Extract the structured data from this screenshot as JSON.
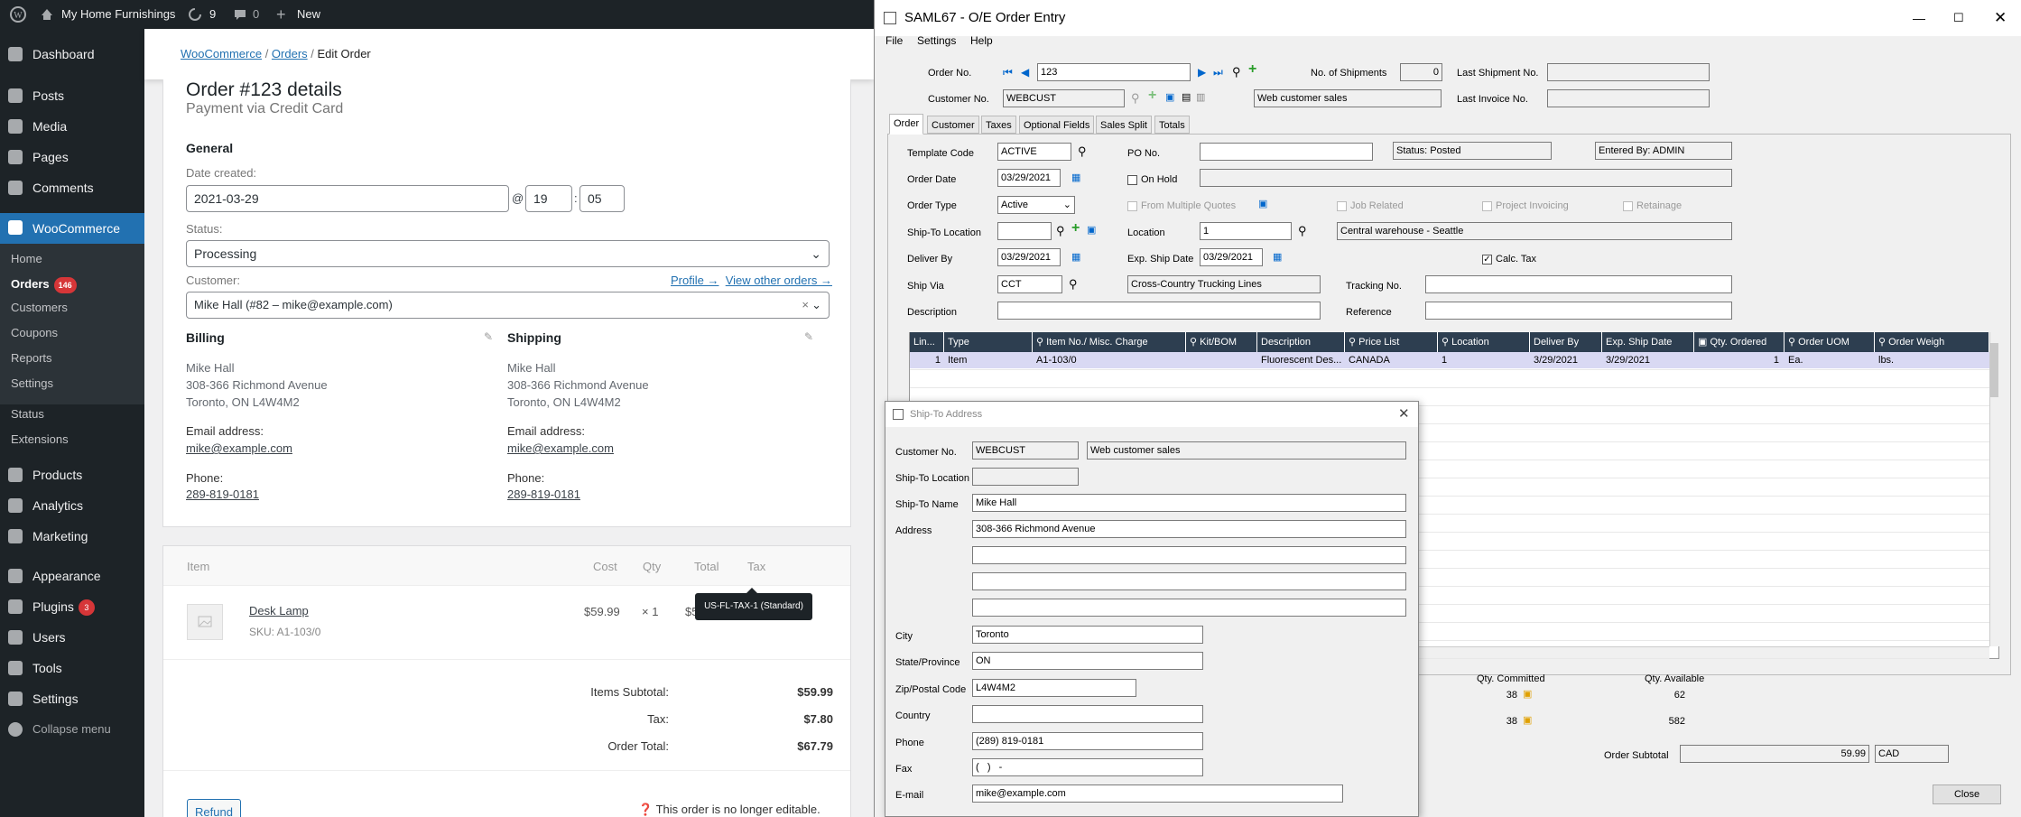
{
  "adminbar": {
    "site_name": "My Home Furnishings",
    "updates_count": "9",
    "comments_count": "0",
    "new_label": "New"
  },
  "sidebar": {
    "items": [
      {
        "label": "Dashboard"
      },
      {
        "label": "Posts"
      },
      {
        "label": "Media"
      },
      {
        "label": "Pages"
      },
      {
        "label": "Comments"
      },
      {
        "label": "WooCommerce"
      },
      {
        "label": "Products"
      },
      {
        "label": "Analytics"
      },
      {
        "label": "Marketing"
      },
      {
        "label": "Appearance"
      },
      {
        "label": "Plugins"
      },
      {
        "label": "Users"
      },
      {
        "label": "Tools"
      },
      {
        "label": "Settings"
      },
      {
        "label": "Collapse menu"
      }
    ],
    "plugins_badge": "3",
    "woo_sub": [
      {
        "label": "Home"
      },
      {
        "label": "Orders"
      },
      {
        "label": "Customers"
      },
      {
        "label": "Coupons"
      },
      {
        "label": "Reports"
      },
      {
        "label": "Settings"
      },
      {
        "label": "Status"
      },
      {
        "label": "Extensions"
      }
    ],
    "orders_badge": "146"
  },
  "breadcrumb": {
    "root": "WooCommerce",
    "orders": "Orders",
    "current": "Edit Order"
  },
  "order": {
    "title": "Order #123 details",
    "payment": "Payment via Credit Card",
    "general_label": "General",
    "date_label": "Date created:",
    "date_value": "2021-03-29",
    "at": "@",
    "hour": "19",
    "colon": ":",
    "minute": "05",
    "status_label": "Status:",
    "status_value": "Processing",
    "customer_label": "Customer:",
    "profile_link": "Profile →",
    "other_orders_link": "View other orders →",
    "customer_value": "Mike Hall (#82 – mike@example.com)",
    "billing": {
      "heading": "Billing",
      "name": "Mike Hall",
      "street": "308-366 Richmond Avenue",
      "city": "Toronto, ON L4W4M2",
      "email_label": "Email address:",
      "email": "mike@example.com",
      "phone_label": "Phone:",
      "phone": "289-819-0181"
    },
    "shipping": {
      "heading": "Shipping",
      "name": "Mike Hall",
      "street": "308-366 Richmond Avenue",
      "city": "Toronto, ON L4W4M2",
      "email_label": "Email address:",
      "email": "mike@example.com",
      "phone_label": "Phone:",
      "phone": "289-819-0181"
    }
  },
  "items": {
    "headers": {
      "item": "Item",
      "cost": "Cost",
      "qty": "Qty",
      "total": "Total",
      "tax": "Tax"
    },
    "row": {
      "name": "Desk Lamp",
      "sku": "SKU: A1-103/0",
      "cost": "$59.99",
      "qty": "× 1",
      "total": "$5"
    },
    "tooltip": "US-FL-TAX-1 (Standard)",
    "subtotal_label": "Items Subtotal:",
    "subtotal": "$59.99",
    "tax_label": "Tax:",
    "tax": "$7.80",
    "total_label": "Order Total:",
    "total": "$67.79",
    "refund_label": "Refund",
    "not_editable": "This order is no longer editable."
  },
  "sage": {
    "title": "SAML67 - O/E Order Entry",
    "menu": [
      "File",
      "Settings",
      "Help"
    ],
    "order_no_label": "Order No.",
    "order_no": "123",
    "customer_no_label": "Customer No.",
    "customer_no": "WEBCUST",
    "customer_name": "Web customer sales",
    "shipments_label": "No. of Shipments",
    "shipments": "0",
    "last_shipment_label": "Last Shipment No.",
    "last_invoice_label": "Last Invoice No.",
    "tabs": [
      "Order",
      "Customer",
      "Taxes",
      "Optional Fields",
      "Sales Split",
      "Totals"
    ],
    "template_label": "Template Code",
    "template": "ACTIVE",
    "po_label": "PO No.",
    "status": "Status: Posted",
    "entered_by": "Entered By: ADMIN",
    "order_date_label": "Order Date",
    "order_date": "03/29/2021",
    "on_hold_label": "On Hold",
    "order_type_label": "Order Type",
    "order_type": "Active",
    "from_quotes_label": "From Multiple Quotes",
    "job_related_label": "Job Related",
    "project_invoicing_label": "Project Invoicing",
    "retainage_label": "Retainage",
    "shipto_loc_label": "Ship-To Location",
    "location_label": "Location",
    "location": "1",
    "location_desc": "Central warehouse - Seattle",
    "deliver_by_label": "Deliver By",
    "deliver_by": "03/29/2021",
    "exp_ship_label": "Exp. Ship Date",
    "exp_ship": "03/29/2021",
    "calc_tax_label": "Calc. Tax",
    "ship_via_label": "Ship Via",
    "ship_via": "CCT",
    "ship_via_desc": "Cross-Country Trucking Lines",
    "tracking_label": "Tracking No.",
    "description_label": "Description",
    "reference_label": "Reference",
    "grid_headers": [
      "Lin...",
      "Type",
      "Item No./ Misc. Charge",
      "Kit/BOM",
      "Description",
      "Price List",
      "Location",
      "Deliver By",
      "Exp. Ship Date",
      "Qty. Ordered",
      "Order UOM",
      "Order Weigh"
    ],
    "grid_row": [
      "1",
      "Item",
      "A1-103/0",
      "",
      "Fluorescent Des...",
      "CANADA",
      "1",
      "3/29/2021",
      "3/29/2021",
      "1",
      "Ea.",
      "lbs."
    ],
    "qty_committed_label": "Qty. Committed",
    "qty_available_label": "Qty. Available",
    "committed_1": "38",
    "available_1": "62",
    "committed_2": "38",
    "available_2": "582",
    "order_subtotal_label": "Order Subtotal",
    "order_subtotal": "59.99",
    "currency": "CAD",
    "close_label": "Close"
  },
  "dialog": {
    "title": "Ship-To Address",
    "customer_no_label": "Customer No.",
    "customer_no": "WEBCUST",
    "customer_name": "Web customer sales",
    "shipto_loc_label": "Ship-To Location",
    "shipto_name_label": "Ship-To Name",
    "shipto_name": "Mike Hall",
    "address_label": "Address",
    "address1": "308-366 Richmond Avenue",
    "city_label": "City",
    "city": "Toronto",
    "state_label": "State/Province",
    "state": "ON",
    "zip_label": "Zip/Postal Code",
    "zip": "L4W4M2",
    "country_label": "Country",
    "phone_label": "Phone",
    "phone": "(289) 819-0181",
    "fax_label": "Fax",
    "fax": "(   )   -",
    "email_label": "E-mail",
    "email": "mike@example.com"
  }
}
